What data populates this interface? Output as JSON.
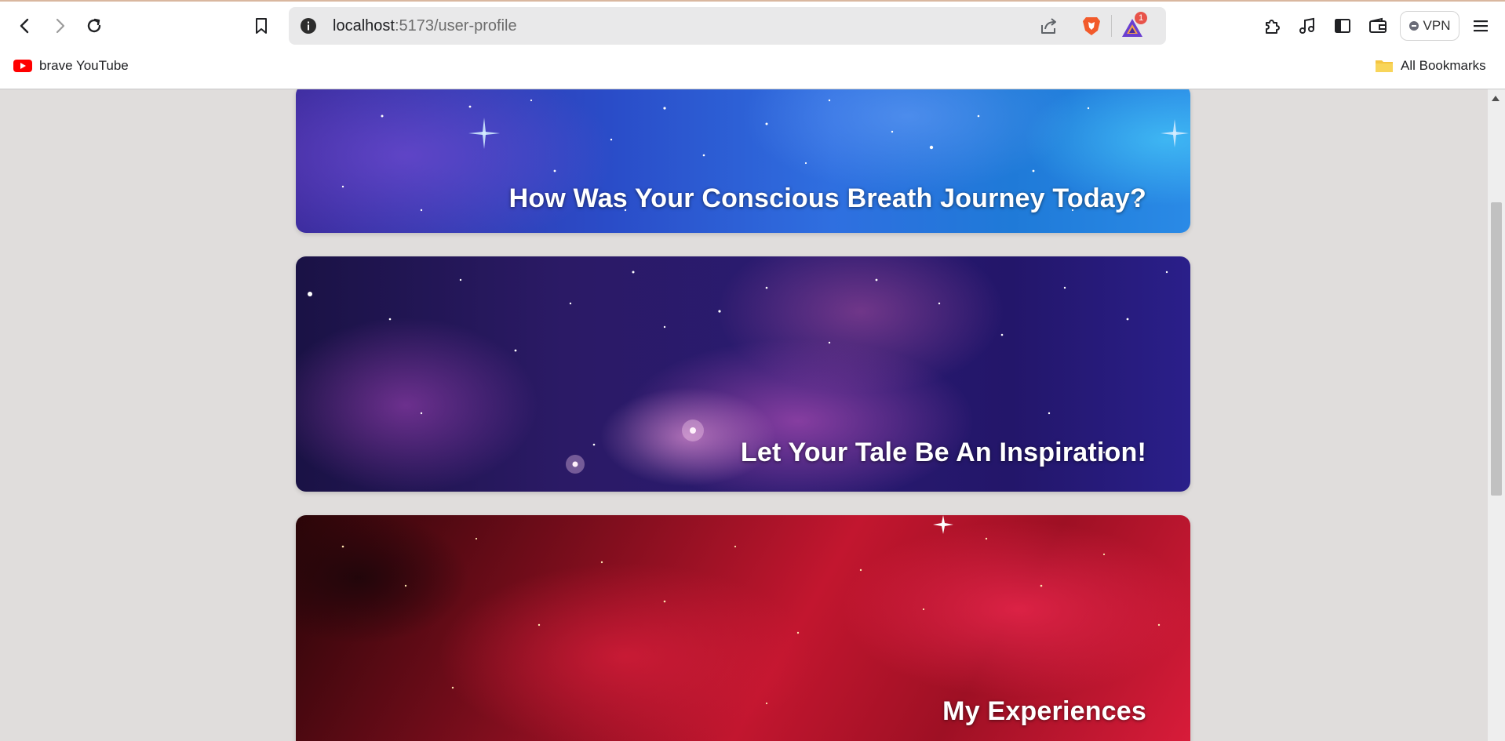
{
  "browser": {
    "url_host": "localhost",
    "url_path": ":5173/user-profile",
    "notification_badge": "1",
    "vpn_label": "VPN"
  },
  "bookmarks": {
    "left_item": "brave YouTube",
    "right_item": "All Bookmarks"
  },
  "page": {
    "banners": [
      {
        "caption": "How Was Your Conscious Breath Journey Today?",
        "theme": "blue-starfield"
      },
      {
        "caption": "Let Your Tale Be An Inspiration!",
        "theme": "purple-nebula"
      },
      {
        "caption": "My Experiences",
        "theme": "red-nebula"
      }
    ]
  },
  "colors": {
    "brave_orange": "#f25a2b",
    "youtube_red": "#ff0000",
    "page_background": "#e0dddc"
  },
  "icons": [
    "back-icon",
    "forward-icon",
    "reload-icon",
    "bookmark-icon",
    "info-icon",
    "share-icon",
    "brave-shield-icon",
    "brave-rewards-icon",
    "extensions-icon",
    "media-icon",
    "sidebar-icon",
    "wallet-icon",
    "menu-icon",
    "youtube-icon",
    "folder-icon"
  ]
}
